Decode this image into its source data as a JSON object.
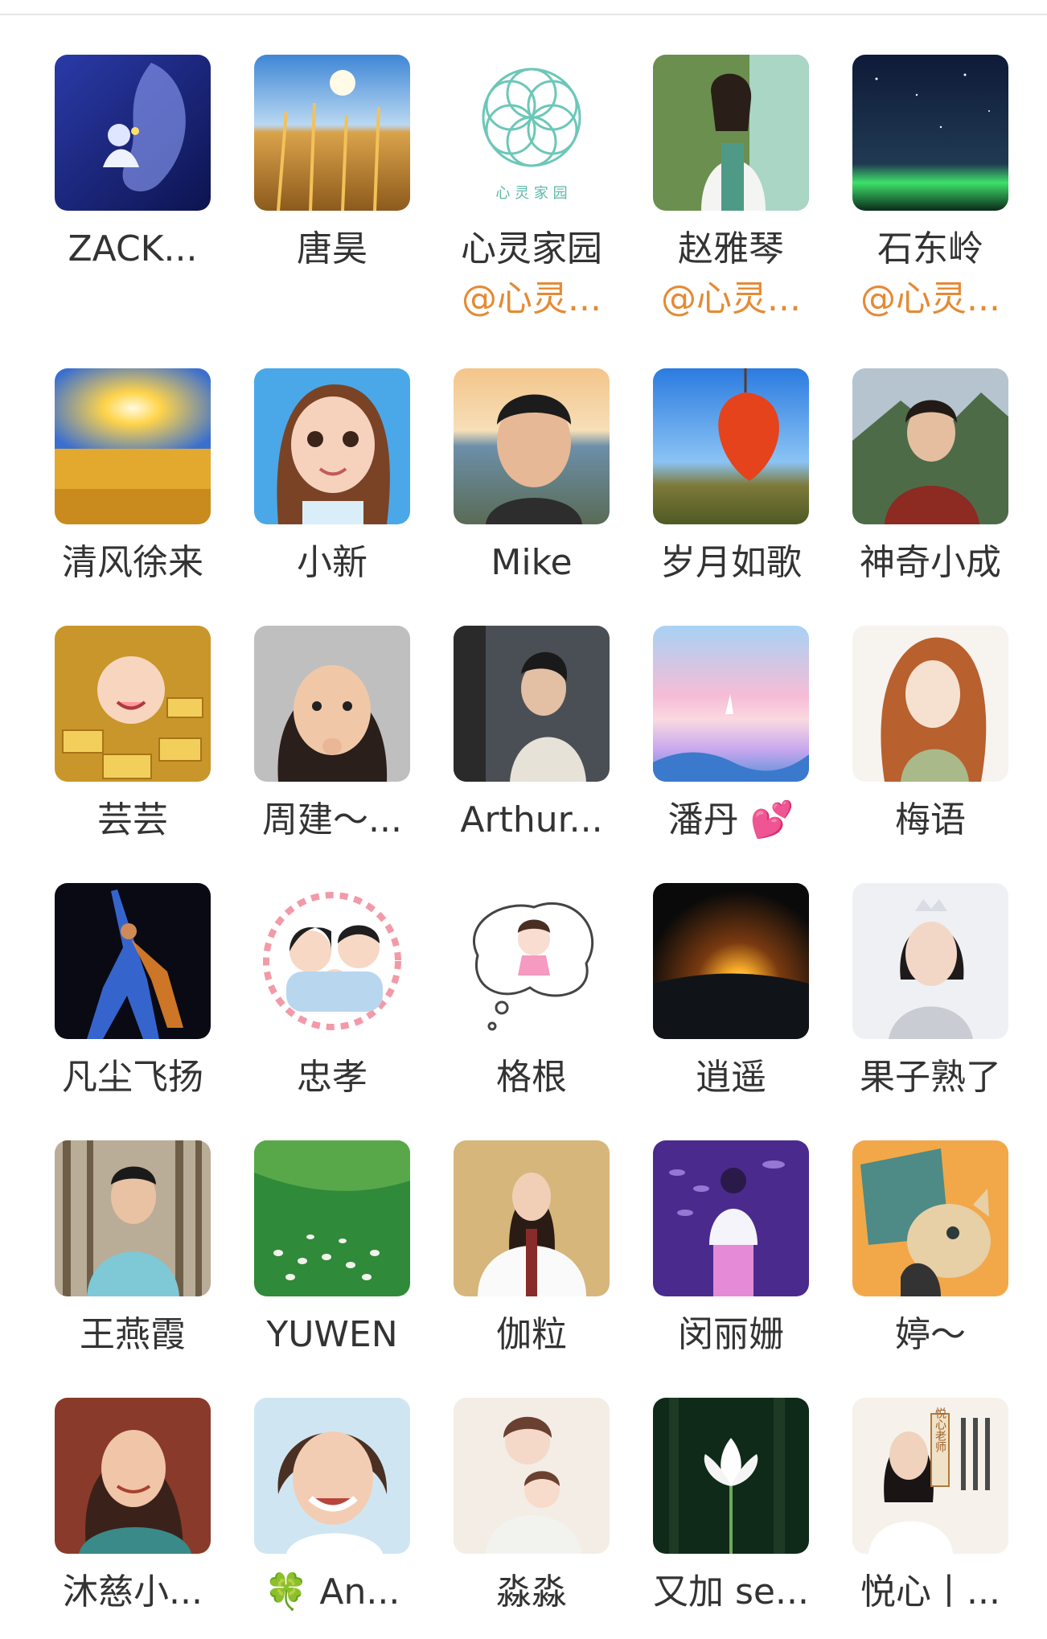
{
  "colors": {
    "background": "#ffffff",
    "name_text": "#333333",
    "tag_text": "#e58a34",
    "divider": "#e6e6e6"
  },
  "members": [
    {
      "name": "ZACK...",
      "avatar_icon": "fantasy-embrace-avatar"
    },
    {
      "name": "唐昊",
      "avatar_icon": "wheat-field-avatar"
    },
    {
      "name": "心灵家园",
      "tag": "@心灵...",
      "avatar_icon": "flower-logo-avatar",
      "avatar_text": "心 灵 家 园"
    },
    {
      "name": "赵雅琴",
      "tag": "@心灵...",
      "avatar_icon": "woman-portrait-avatar"
    },
    {
      "name": "石东岭",
      "tag": "@心灵...",
      "avatar_icon": "night-sky-avatar"
    },
    {
      "name": "清风徐来",
      "avatar_icon": "sunrise-field-avatar"
    },
    {
      "name": "小新",
      "avatar_icon": "cartoon-girl-avatar"
    },
    {
      "name": "Mike",
      "avatar_icon": "man-selfie-avatar"
    },
    {
      "name": "岁月如歌",
      "avatar_icon": "red-lantern-avatar"
    },
    {
      "name": "神奇小成",
      "avatar_icon": "man-mountain-avatar"
    },
    {
      "name": "芸芸",
      "avatar_icon": "baby-gold-avatar"
    },
    {
      "name": "周建～...",
      "avatar_icon": "girl-photo-avatar"
    },
    {
      "name": "Arthur...",
      "avatar_icon": "man-profile-avatar"
    },
    {
      "name": "潘丹",
      "name_emoji": "💕",
      "avatar_icon": "pastel-sea-avatar"
    },
    {
      "name": "梅语",
      "avatar_icon": "anime-woman-avatar"
    },
    {
      "name": "凡尘飞扬",
      "avatar_icon": "dancer-avatar"
    },
    {
      "name": "忠孝",
      "avatar_icon": "family-cartoon-avatar"
    },
    {
      "name": "格根",
      "avatar_icon": "thought-bubble-avatar"
    },
    {
      "name": "逍遥",
      "avatar_icon": "earth-sunrise-avatar"
    },
    {
      "name": "果子熟了",
      "avatar_icon": "woman-crown-avatar"
    },
    {
      "name": "王燕霞",
      "avatar_icon": "woman-forest-avatar"
    },
    {
      "name": "YUWEN",
      "avatar_icon": "sheep-meadow-avatar"
    },
    {
      "name": "伽粒",
      "avatar_icon": "woman-fur-avatar"
    },
    {
      "name": "闵丽姗",
      "avatar_icon": "dream-fish-avatar"
    },
    {
      "name": "婷～",
      "avatar_icon": "cat-cartoon-avatar"
    },
    {
      "name": "沐慈小...",
      "avatar_icon": "woman-smile-avatar"
    },
    {
      "name": "An...",
      "name_emoji": "🍀",
      "avatar_icon": "woman-short-hair-avatar"
    },
    {
      "name": "淼淼",
      "avatar_icon": "mother-child-avatar"
    },
    {
      "name": "又加 se...",
      "avatar_icon": "lotus-avatar"
    },
    {
      "name": "悦心丨...",
      "avatar_icon": "teacher-poster-avatar",
      "avatar_text": "悦心老师"
    }
  ]
}
